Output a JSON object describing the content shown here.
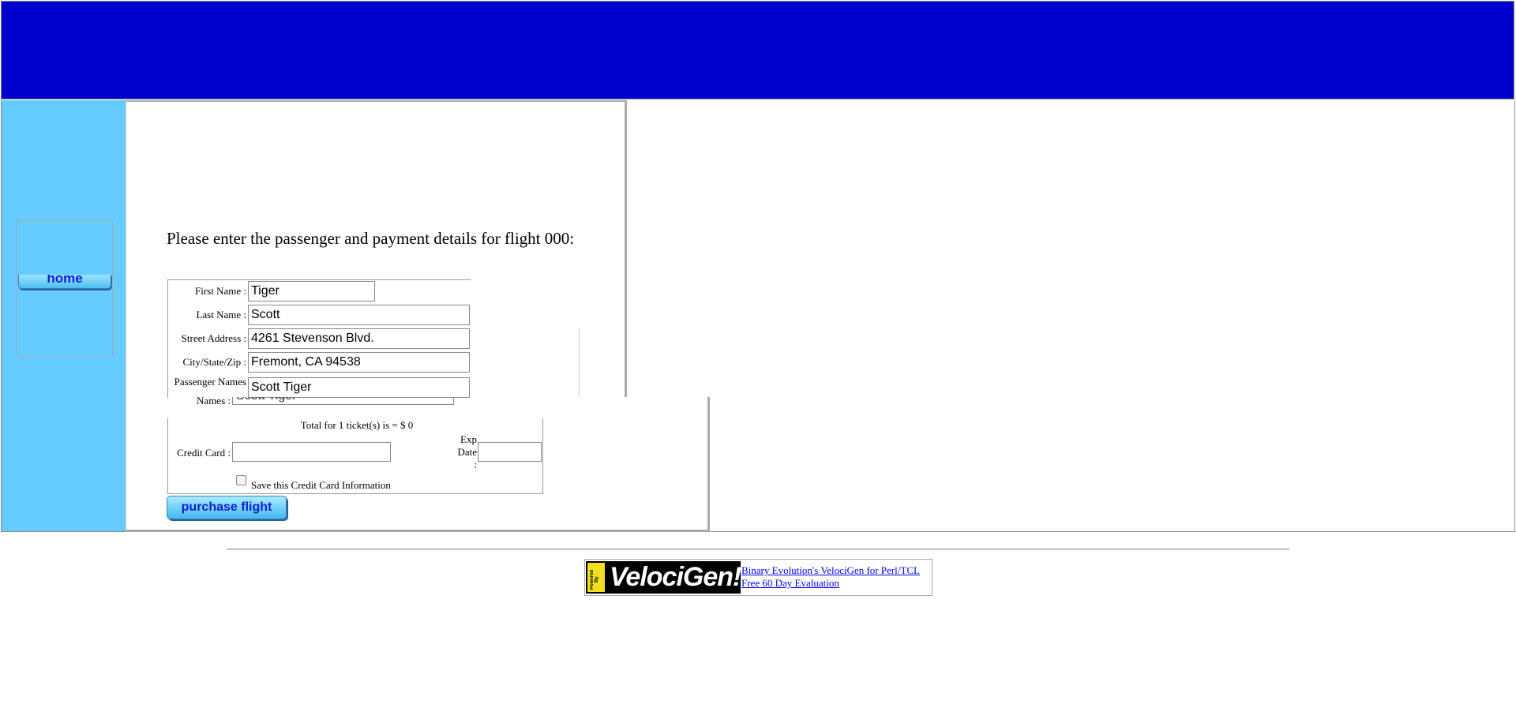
{
  "nav": {
    "home_label": "home"
  },
  "form": {
    "heading": "Please enter the passenger and payment details for flight 000:",
    "first_name_label": "First Name :",
    "first_name_value": "Tiger",
    "last_name_label": "Last Name :",
    "last_name_value": "Scott",
    "street_label": "Street Address :",
    "street_value": "4261 Stevenson Blvd.",
    "city_label": "City/State/Zip :",
    "city_value": "Fremont, CA 94538",
    "passenger_label": "Passenger Names",
    "passenger_value": "Scott Tiger",
    "passenger_label_echo": "Names :",
    "passenger_value_echo": "Scott Tiger",
    "total_text": "Total for 1 ticket(s) is = $ 0",
    "credit_card_label": "Credit Card :",
    "credit_card_value": "",
    "exp_label_1": "Exp",
    "exp_label_2": "Date",
    "exp_label_3": ":",
    "exp_value": "",
    "save_cc_label": "Save this Credit Card Information",
    "save_cc_checked": false,
    "purchase_label": "purchase flight"
  },
  "footer": {
    "badge_powered": "Powered By",
    "badge_text": "VelociGen!",
    "link1": "Binary Evolution's VelociGen for Perl/TCL",
    "link2": "Free 60 Day Evaluation"
  },
  "colors": {
    "top_frame": "#0000cc",
    "nav_frame": "#66ccff",
    "button_text": "#1020d0"
  }
}
